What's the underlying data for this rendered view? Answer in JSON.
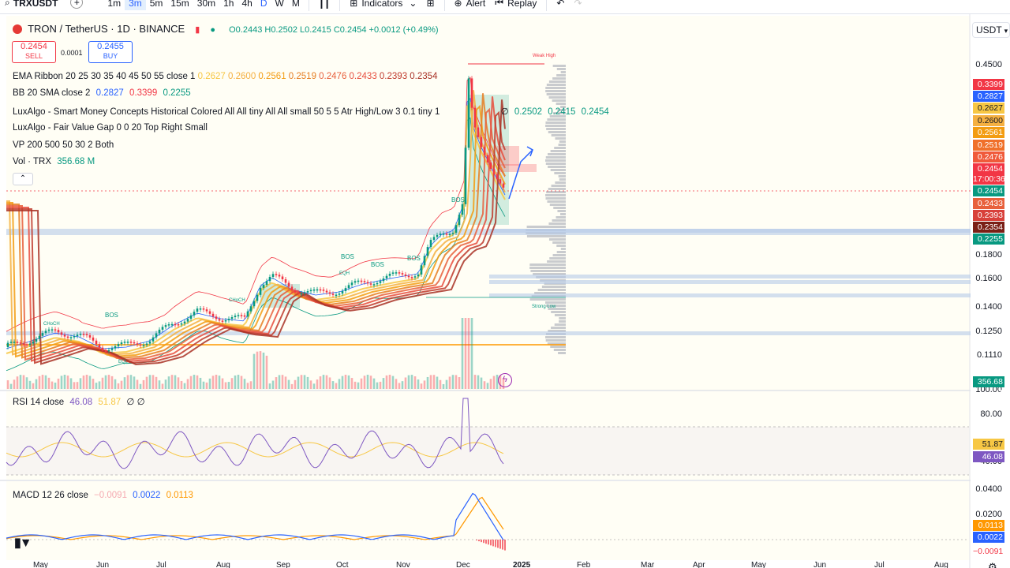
{
  "toolbar": {
    "symbol": "TRXUSDT",
    "add_label": "+",
    "timeframes": [
      "1m",
      "3m",
      "5m",
      "15m",
      "30m",
      "1h",
      "4h",
      "D",
      "W",
      "M"
    ],
    "active_timeframe": "3m",
    "indicators_label": "Indicators",
    "alert_label": "Alert",
    "replay_label": "Replay"
  },
  "header": {
    "title": "TRON / TetherUS · 1D · BINANCE",
    "ohlc": {
      "o": "O0.2443",
      "h": "H0.2502",
      "l": "L0.2415",
      "c": "C0.2454",
      "change": "+0.0012 (+0.49%)"
    },
    "sell_price": "0.2454",
    "sell_label": "SELL",
    "spread": "0.0001",
    "buy_price": "0.2455",
    "buy_label": "BUY",
    "currency": "USDT"
  },
  "legend": {
    "ema": {
      "label": "EMA Ribbon 20 25 30 35 40 45 50 55 close 1",
      "values": [
        "0.2627",
        "0.2600",
        "0.2561",
        "0.2519",
        "0.2476",
        "0.2433",
        "0.2393",
        "0.2354"
      ],
      "colors": [
        "#f7c744",
        "#f5b041",
        "#f39c12",
        "#e67e22",
        "#e8603c",
        "#e74c3c",
        "#c0392b",
        "#a93226"
      ]
    },
    "bb": {
      "label": "BB 20 SMA close 2",
      "basis": "0.2827",
      "upper": "0.3399",
      "lower": "0.2255"
    },
    "smc": {
      "label": "LuxAlgo - Smart Money Concepts Historical Colored All All tiny All All small 50 5 5 Atr High/Low 3 0.1 tiny 1",
      "values": [
        "∅",
        "0.2502",
        "0.2415",
        "0.2454"
      ]
    },
    "fvg": {
      "label": "LuxAlgo - Fair Value Gap 0 0 20 Top Right Small"
    },
    "vp": {
      "label": "VP 200 500 50 30 2 Both"
    },
    "vol": {
      "label": "Vol · TRX",
      "value": "356.68 M"
    }
  },
  "price_axis": [
    "0.4500",
    "0.1800",
    "0.1600",
    "0.1400",
    "0.1250",
    "0.1110"
  ],
  "price_tags": [
    {
      "value": "0.3399",
      "color": "#f23645"
    },
    {
      "value": "0.2827",
      "color": "#2962ff"
    },
    {
      "value": "0.2627",
      "color": "#f7c744"
    },
    {
      "value": "0.2600",
      "color": "#f5b041"
    },
    {
      "value": "0.2561",
      "color": "#f39c12"
    },
    {
      "value": "0.2519",
      "color": "#f0702a"
    },
    {
      "value": "0.2476",
      "color": "#f05a3a"
    },
    {
      "value": "0.2454",
      "color": "#f23645"
    },
    {
      "value": "17:00:36",
      "color": "#f23645"
    },
    {
      "value": "0.2454",
      "color": "#089981"
    },
    {
      "value": "0.2433",
      "color": "#e8603c"
    },
    {
      "value": "0.2393",
      "color": "#d8403a"
    },
    {
      "value": "0.2354",
      "color": "#7a1f16"
    },
    {
      "value": "0.2255",
      "color": "#089981"
    }
  ],
  "volume_tag": "356.68 M",
  "rsi": {
    "label": "RSI 14 close",
    "value": "46.08",
    "ma": "51.87",
    "extra": "∅ ∅",
    "axis": [
      "100.00",
      "80.00",
      "40.00"
    ],
    "tag_value": "46.08",
    "tag_ma": "51.87"
  },
  "macd": {
    "label": "MACD 12 26 close",
    "hist": "−0.0091",
    "macd": "0.0022",
    "signal": "0.0113",
    "axis": [
      "0.0400",
      "0.0200"
    ],
    "tag_signal": "0.0113",
    "tag_macd": "0.0022",
    "tag_hist": "−0.0091"
  },
  "x_axis": [
    "May",
    "Jun",
    "Jul",
    "Aug",
    "Sep",
    "Oct",
    "Nov",
    "Dec",
    "2025",
    "Feb",
    "Mar",
    "Apr",
    "May",
    "Jun",
    "Jul",
    "Aug"
  ],
  "annotations": {
    "bos": "BOS",
    "choch": "CHoCH",
    "eqh": "EQH",
    "eql": "EQL",
    "weak_high": "Weak High",
    "strong_low": "Strong Low"
  },
  "colors": {
    "up": "#089981",
    "down": "#f23645",
    "accent": "#2962ff"
  }
}
